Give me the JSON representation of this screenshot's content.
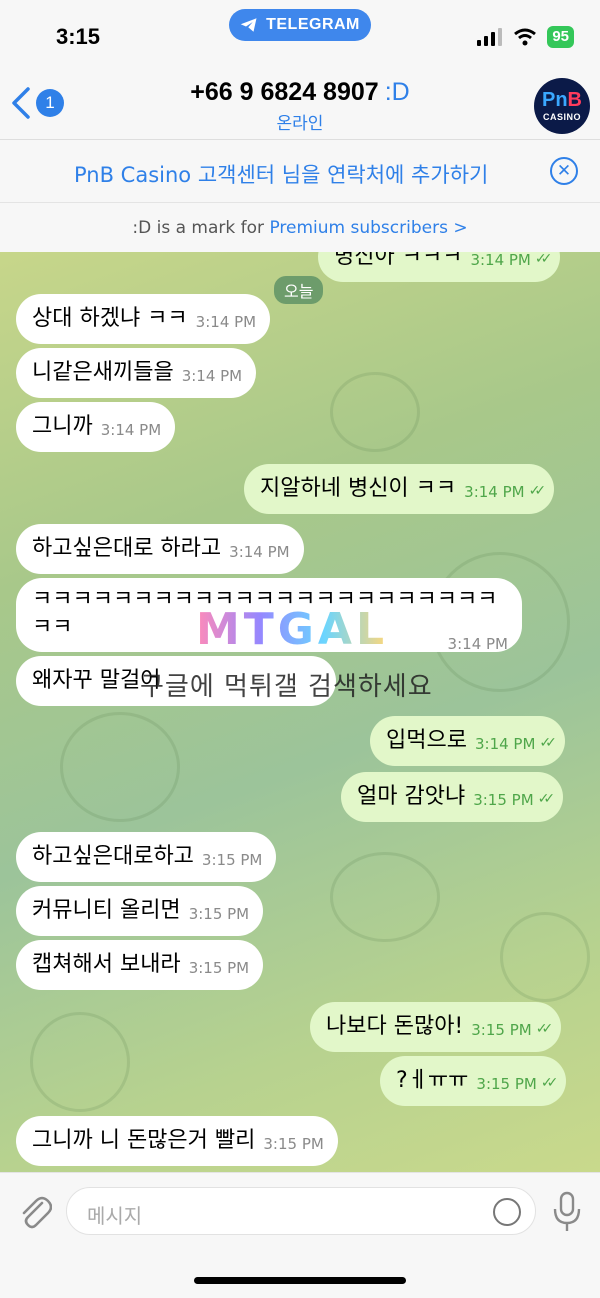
{
  "status": {
    "time": "3:15",
    "app_pill": "TELEGRAM",
    "battery": "95"
  },
  "header": {
    "back_count": "1",
    "title": "+66 9 6824 8907",
    "title_mark": ":D",
    "subtitle": "온라인",
    "avatar_top": "PnB",
    "avatar_bottom": "CASINO"
  },
  "add_contact": {
    "text": "PnB Casino 고객센터 님을 연락처에 추가하기"
  },
  "premium": {
    "prefix": ":D is a mark for ",
    "link": "Premium subscribers",
    "chevron": ">"
  },
  "chat": {
    "date_chip": "오늘",
    "messages": [
      {
        "dir": "out",
        "text": "병신아 ㅋㅋㅋ",
        "time": "3:14 PM"
      },
      {
        "dir": "in",
        "text": "상대 하겠냐 ㅋㅋ",
        "time": "3:14 PM"
      },
      {
        "dir": "in",
        "text": "니같은새끼들을",
        "time": "3:14 PM"
      },
      {
        "dir": "in",
        "text": "그니까",
        "time": "3:14 PM"
      },
      {
        "dir": "out",
        "text": "지알하네 병신이 ㅋㅋ",
        "time": "3:14 PM"
      },
      {
        "dir": "in",
        "text": "하고싶은대로 하라고",
        "time": "3:14 PM"
      },
      {
        "dir": "in",
        "text": "ㅋㅋㅋㅋㅋㅋㅋㅋㅋㅋㅋㅋㅋㅋㅋㅋㅋㅋㅋㅋㅋㅋㅋㅋㅋ",
        "time": "3:14 PM"
      },
      {
        "dir": "in",
        "text": "왜자꾸 말걸어",
        "time": ""
      },
      {
        "dir": "out",
        "text": "입먹으로",
        "time": "3:14 PM"
      },
      {
        "dir": "out",
        "text": "얼마 감앗냐",
        "time": "3:15 PM"
      },
      {
        "dir": "in",
        "text": "하고싶은대로하고",
        "time": "3:15 PM"
      },
      {
        "dir": "in",
        "text": "커뮤니티 올리면",
        "time": "3:15 PM"
      },
      {
        "dir": "in",
        "text": "캡쳐해서 보내라",
        "time": "3:15 PM"
      },
      {
        "dir": "out",
        "text": "나보다 돈많아!",
        "time": "3:15 PM"
      },
      {
        "dir": "out",
        "text": "?ㅔㅠㅠ",
        "time": "3:15 PM"
      },
      {
        "dir": "in",
        "text": "그니까 니 돈많은거 빨리",
        "time": "3:15 PM"
      }
    ],
    "watermark": "MTGAL",
    "overlay": "구글에 먹튀갤 검색하세요"
  },
  "input": {
    "placeholder": "메시지"
  },
  "icons": [
    "telegram-icon",
    "signal-icon",
    "wifi-icon",
    "back-chevron-icon",
    "close-circle-icon",
    "paperclip-icon",
    "sticker-icon",
    "mic-icon"
  ]
}
